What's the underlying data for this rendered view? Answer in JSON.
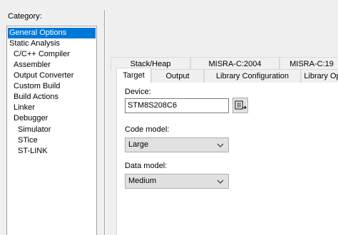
{
  "category": {
    "label": "Category:",
    "items": [
      {
        "label": "General Options",
        "selected": true
      },
      {
        "label": "Static Analysis"
      },
      {
        "label": "C/C++ Compiler"
      },
      {
        "label": "Assembler"
      },
      {
        "label": "Output Converter"
      },
      {
        "label": "Custom Build"
      },
      {
        "label": "Build Actions"
      },
      {
        "label": "Linker"
      },
      {
        "label": "Debugger"
      },
      {
        "label": "Simulator"
      },
      {
        "label": "STice"
      },
      {
        "label": "ST-LINK"
      }
    ]
  },
  "tabs": {
    "top_row": [
      "Stack/Heap",
      "MISRA-C:2004",
      "MISRA-C:19"
    ],
    "bottom_row": [
      "Target",
      "Output",
      "Library Configuration",
      "Library Op"
    ],
    "active": "Target"
  },
  "target": {
    "device_label": "Device:",
    "device_value": "STM8S208C6",
    "code_model_label": "Code model:",
    "code_model_value": "Large",
    "data_model_label": "Data model:",
    "data_model_value": "Medium"
  },
  "colors": {
    "selection": "#0078d7",
    "background": "#f0f0f0"
  }
}
